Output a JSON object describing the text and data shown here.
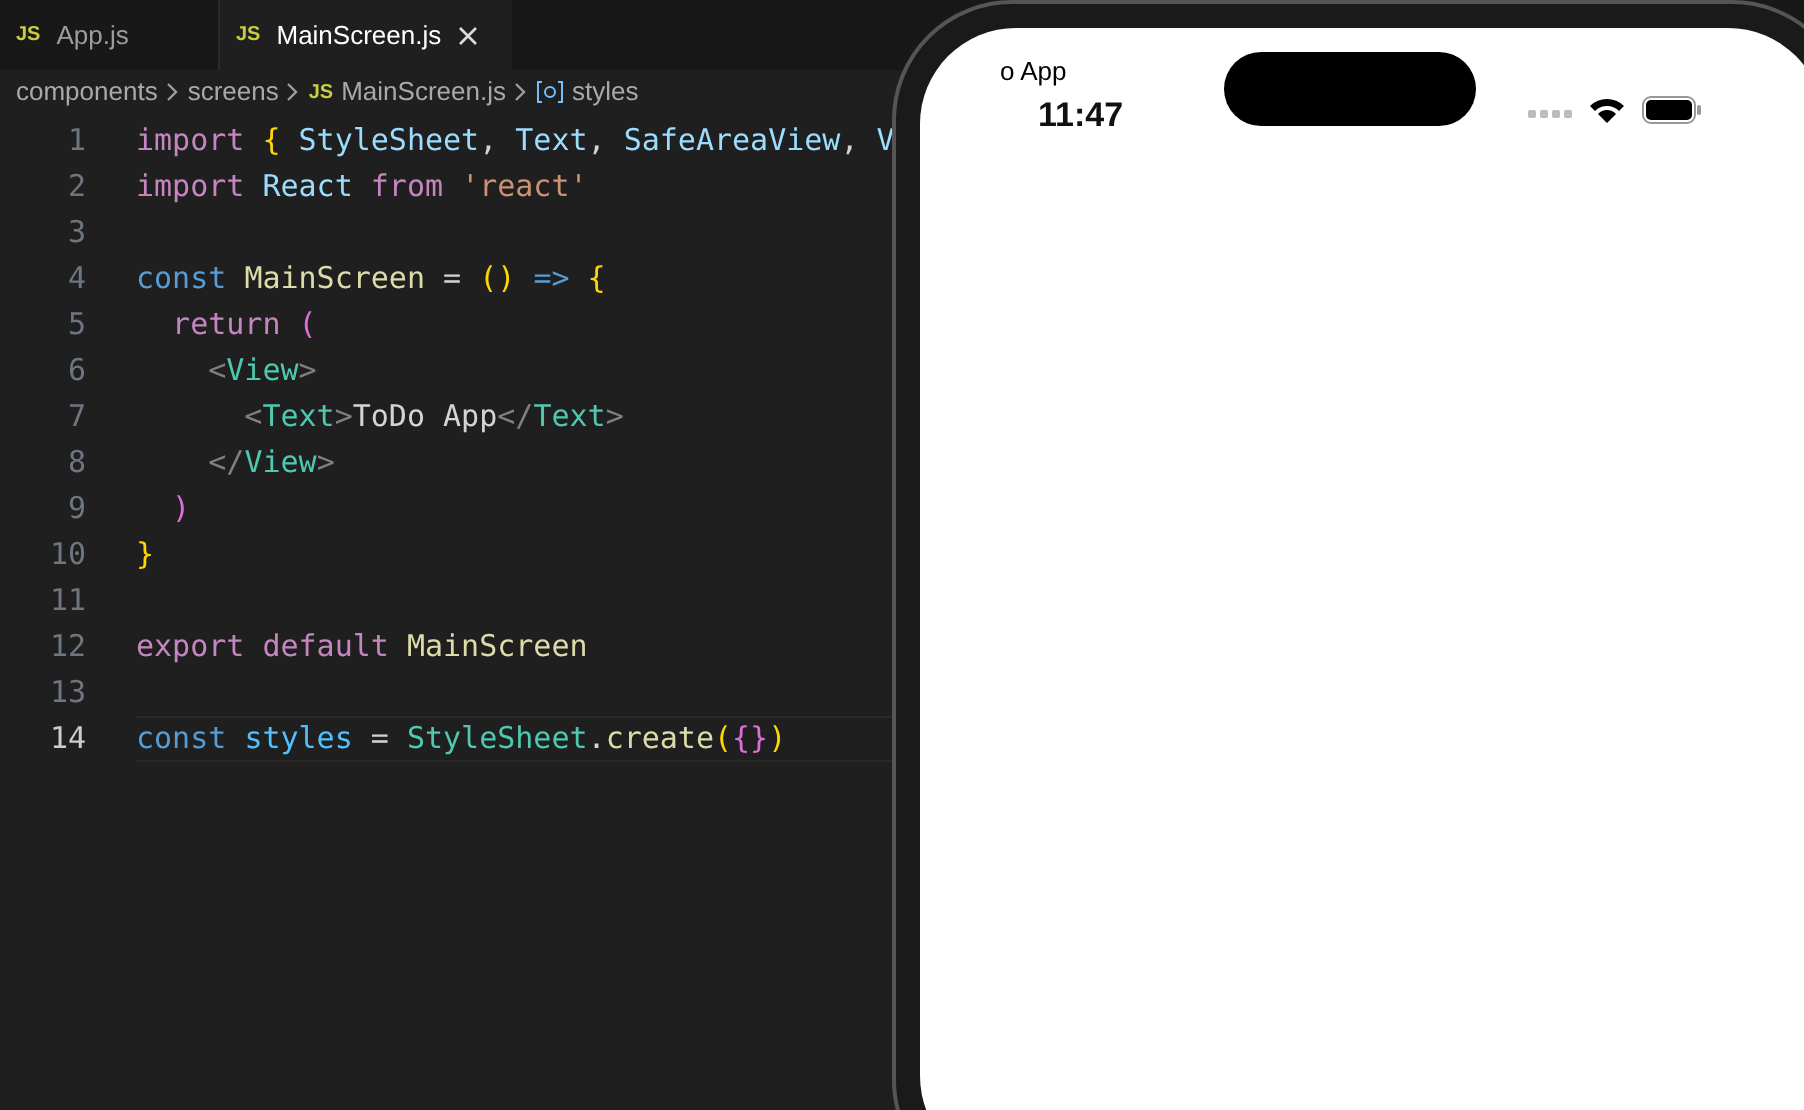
{
  "tabs": [
    {
      "label": "App.js",
      "badge": "JS",
      "selected": false
    },
    {
      "label": "MainScreen.js",
      "badge": "JS",
      "selected": true
    }
  ],
  "breadcrumbs": [
    {
      "label": "components",
      "kind": "folder"
    },
    {
      "label": "screens",
      "kind": "folder"
    },
    {
      "label": "MainScreen.js",
      "kind": "file",
      "badge": "JS"
    },
    {
      "label": "styles",
      "kind": "symbol"
    }
  ],
  "lines": [
    {
      "number": "1",
      "current": false,
      "tokens": [
        {
          "text": "import ",
          "kind": "keyword"
        },
        {
          "text": "{ ",
          "kind": "bracket"
        },
        {
          "text": "StyleSheet",
          "kind": "var"
        },
        {
          "text": ", ",
          "kind": "plain"
        },
        {
          "text": "Text",
          "kind": "var"
        },
        {
          "text": ", ",
          "kind": "plain"
        },
        {
          "text": "SafeAreaView",
          "kind": "var"
        },
        {
          "text": ", ",
          "kind": "plain"
        },
        {
          "text": "V",
          "kind": "var"
        }
      ]
    },
    {
      "number": "2",
      "current": false,
      "tokens": [
        {
          "text": "import ",
          "kind": "keyword"
        },
        {
          "text": "React ",
          "kind": "var"
        },
        {
          "text": "from ",
          "kind": "keyword"
        },
        {
          "text": "'react'",
          "kind": "string"
        }
      ]
    },
    {
      "number": "3",
      "current": false
    },
    {
      "number": "4",
      "current": false,
      "tokens": [
        {
          "text": "const ",
          "kind": "storage"
        },
        {
          "text": "MainScreen",
          "kind": "func"
        },
        {
          "text": " = ",
          "kind": "plain"
        },
        {
          "text": "() ",
          "kind": "bracket"
        },
        {
          "text": "=> ",
          "kind": "storage"
        },
        {
          "text": "{",
          "kind": "bracket"
        }
      ]
    },
    {
      "number": "5",
      "current": false,
      "tokens": [
        {
          "text": "  return ",
          "kind": "keyword"
        },
        {
          "text": "(",
          "kind": "bracket2"
        }
      ]
    },
    {
      "number": "6",
      "current": false,
      "tokens": [
        {
          "text": "    <",
          "kind": "punct"
        },
        {
          "text": "View",
          "kind": "tag"
        },
        {
          "text": ">",
          "kind": "punct"
        }
      ]
    },
    {
      "number": "7",
      "current": false,
      "tokens": [
        {
          "text": "      <",
          "kind": "punct"
        },
        {
          "text": "Text",
          "kind": "tag"
        },
        {
          "text": ">",
          "kind": "punct"
        },
        {
          "text": "ToDo App",
          "kind": "plain"
        },
        {
          "text": "</",
          "kind": "punct"
        },
        {
          "text": "Text",
          "kind": "tag"
        },
        {
          "text": ">",
          "kind": "punct"
        }
      ]
    },
    {
      "number": "8",
      "current": false,
      "tokens": [
        {
          "text": "    </",
          "kind": "punct"
        },
        {
          "text": "View",
          "kind": "tag"
        },
        {
          "text": ">",
          "kind": "punct"
        }
      ]
    },
    {
      "number": "9",
      "current": false,
      "tokens": [
        {
          "text": "  )",
          "kind": "bracket2"
        }
      ]
    },
    {
      "number": "10",
      "current": false,
      "tokens": [
        {
          "text": "}",
          "kind": "bracket"
        }
      ]
    },
    {
      "number": "11",
      "current": false
    },
    {
      "number": "12",
      "current": false,
      "tokens": [
        {
          "text": "export ",
          "kind": "keyword"
        },
        {
          "text": "default ",
          "kind": "keyword"
        },
        {
          "text": "MainScreen",
          "kind": "func"
        }
      ]
    },
    {
      "number": "13",
      "current": false
    },
    {
      "number": "14",
      "current": true,
      "tokens": [
        {
          "text": "const ",
          "kind": "storage"
        },
        {
          "text": "styles",
          "kind": "var2"
        },
        {
          "text": " = ",
          "kind": "plain"
        },
        {
          "text": "StyleSheet",
          "kind": "tag"
        },
        {
          "text": ".",
          "kind": "plain"
        },
        {
          "text": "create",
          "kind": "func"
        },
        {
          "text": "(",
          "kind": "bracket"
        },
        {
          "text": "{}",
          "kind": "bracket2"
        },
        {
          "text": ")",
          "kind": "bracket"
        }
      ]
    }
  ],
  "phone": {
    "app_text": "o App",
    "time": "11:47"
  }
}
